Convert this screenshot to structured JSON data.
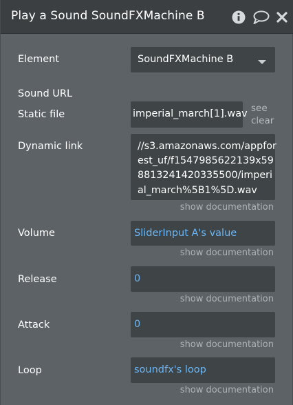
{
  "header": {
    "title": "Play a Sound SoundFXMachine B"
  },
  "fields": {
    "element": {
      "label": "Element",
      "value": "SoundFXMachine B"
    },
    "sound_url": {
      "label": "Sound URL"
    },
    "static_file": {
      "label": "Static file",
      "value": "imperial_march[1].wav",
      "see": "see",
      "clear": "clear"
    },
    "dynamic_link": {
      "label": "Dynamic link",
      "value": "//s3.amazonaws.com/appforest_uf/f1547985622139x598813241420335500/imperial_march%5B1%5D.wav",
      "doc": "show documentation"
    },
    "volume": {
      "label": "Volume",
      "value": "SliderInput A's value",
      "doc": "show documentation"
    },
    "release": {
      "label": "Release",
      "value": "0",
      "doc": "show documentation"
    },
    "attack": {
      "label": "Attack",
      "value": "0",
      "doc": "show documentation"
    },
    "loop": {
      "label": "Loop",
      "value": "soundfx's loop",
      "doc": "show documentation"
    }
  },
  "colors": {
    "header_bg": "#3b3f42",
    "panel_bg": "#5c6266",
    "field_bg": "#3f4447",
    "dynamic_value": "#6cb6f5"
  },
  "icons": [
    "info-icon",
    "comment-icon",
    "close-icon",
    "chevron-down-icon"
  ]
}
